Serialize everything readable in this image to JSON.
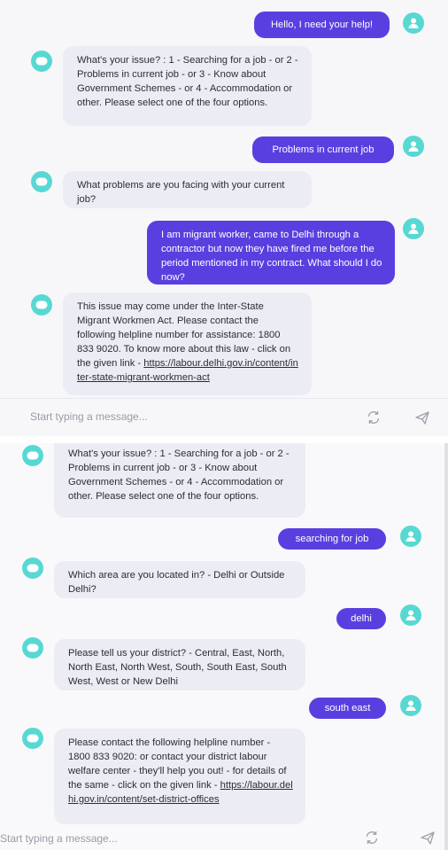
{
  "chat1": {
    "messages": [
      {
        "role": "user",
        "text": "Hello, I need your help!"
      },
      {
        "role": "bot",
        "text": "What's your issue? : 1 - Searching for a job - or 2 - Problems in current job - or 3 - Know about Government Schemes - or 4 - Accommodation or other. Please select one of the four options."
      },
      {
        "role": "user",
        "text": "Problems in current job"
      },
      {
        "role": "bot",
        "text": "What problems are you facing with your current job?"
      },
      {
        "role": "user",
        "text": "I am migrant worker, came to Delhi through a contractor but now they have fired me before the period mentioned in my contract. What should I do now?"
      },
      {
        "role": "bot",
        "text": "This issue may come under the Inter-State Migrant Workmen Act. Please contact the following helpline number for assistance: 1800 833 9020. To know more about this law - click on the given link - ",
        "link": "https://labour.delhi.gov.in/content/inter-state-migrant-workmen-act"
      }
    ],
    "input_placeholder": "Start typing a message..."
  },
  "chat2": {
    "messages": [
      {
        "role": "bot",
        "text": "What's your issue? : 1 - Searching for a job - or 2 - Problems in current job - or 3 - Know about Government Schemes - or 4 - Accommodation or other. Please select one of the four options."
      },
      {
        "role": "user",
        "text": "searching for job"
      },
      {
        "role": "bot",
        "text": "Which area are you located in? - Delhi or Outside Delhi?"
      },
      {
        "role": "user",
        "text": "delhi"
      },
      {
        "role": "bot",
        "text": "Please tell us your district? - Central, East, North, North East, North West, South, South East, South West, West or New Delhi"
      },
      {
        "role": "user",
        "text": "south east"
      },
      {
        "role": "bot",
        "text": "Please contact the following helpline number - 1800 833 9020: or contact your district labour welfare center - they'll help you out! - for details of the same - click on the given link - ",
        "link": "https://labour.delhi.gov.in/content/set-district-offices"
      }
    ],
    "input_placeholder": "Start typing a message..."
  },
  "icons": {
    "avatar": "user-avatar-icon",
    "refresh": "refresh-icon",
    "send": "send-icon"
  },
  "colors": {
    "user_bubble": "#5a3fe0",
    "bot_bubble": "#ececf4",
    "avatar": "#58d8d3",
    "placeholder": "#9a9aa8"
  }
}
